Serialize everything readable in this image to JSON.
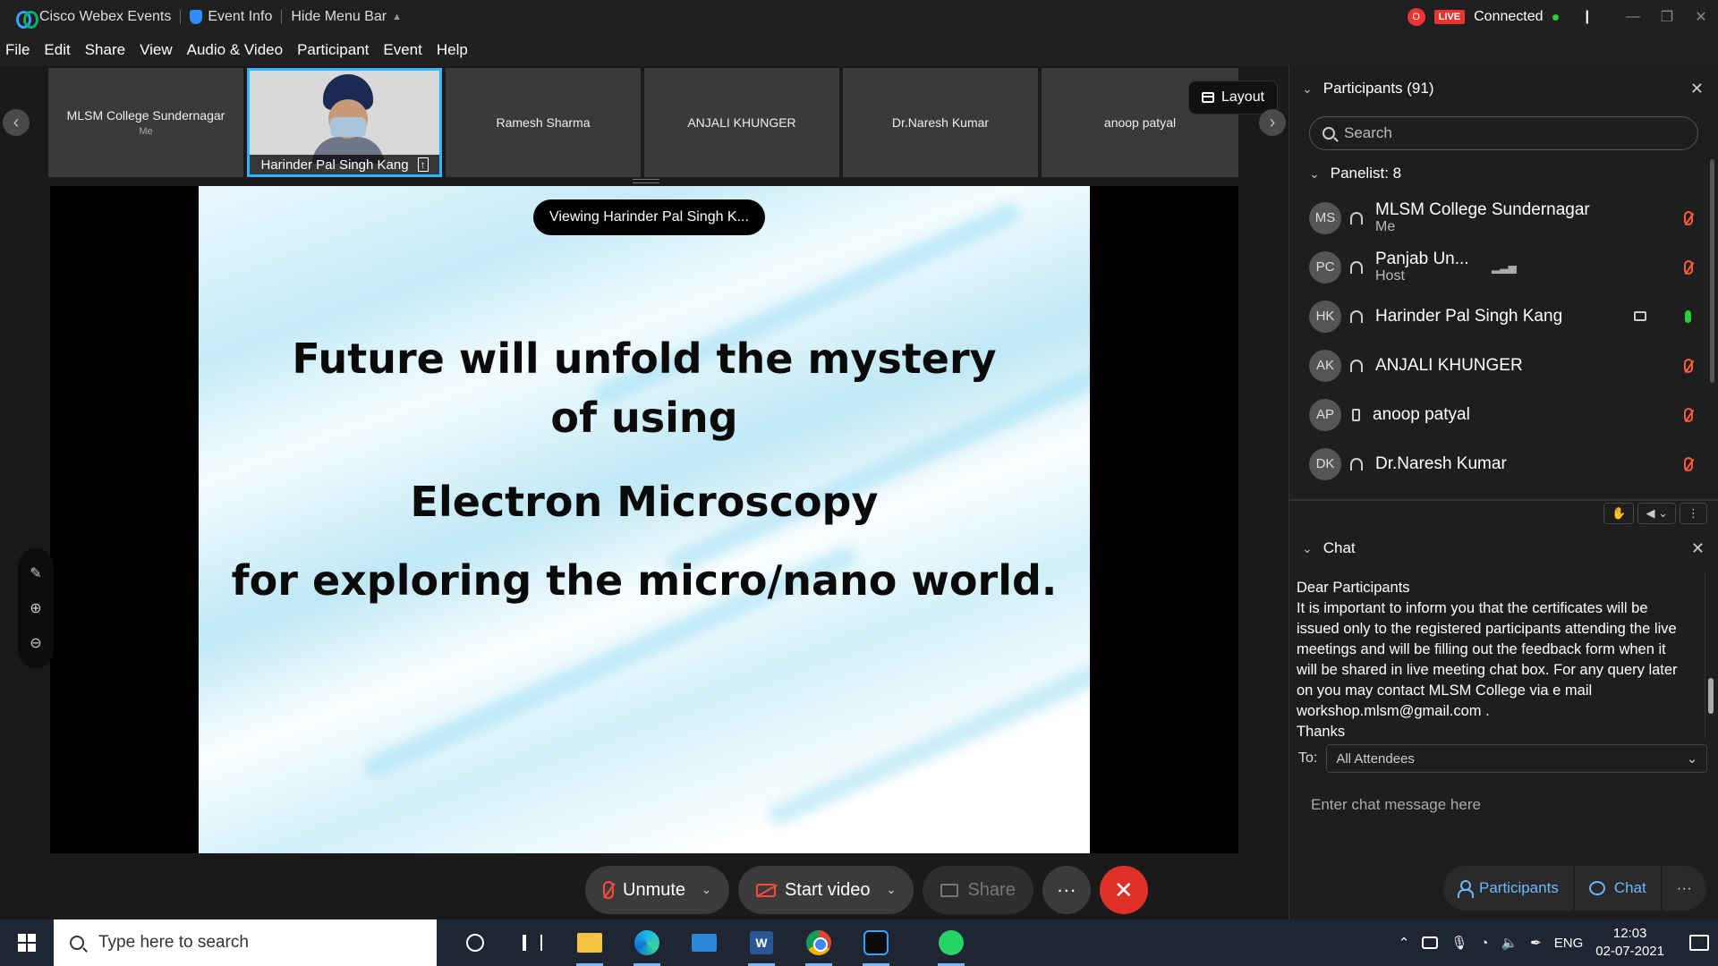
{
  "titlebar": {
    "app_name": "Cisco Webex Events",
    "event_info": "Event Info",
    "hide_menu": "Hide Menu Bar",
    "rec_label": "O",
    "live_label": "LIVE",
    "status": "Connected",
    "cursor_mark": "|"
  },
  "menu": [
    "File",
    "Edit",
    "Share",
    "View",
    "Audio & Video",
    "Participant",
    "Event",
    "Help"
  ],
  "filmstrip": {
    "tiles": [
      {
        "name": "MLSM College Sundernagar",
        "sub": "Me"
      },
      {
        "name": "Harinder Pal Singh Kang"
      },
      {
        "name": "Ramesh Sharma"
      },
      {
        "name": "ANJALI KHUNGER"
      },
      {
        "name": "Dr.Naresh Kumar"
      },
      {
        "name": "anoop patyal"
      }
    ],
    "layout_label": "Layout"
  },
  "viewing_label": "Viewing Harinder Pal Singh K...",
  "slide": {
    "line1": "Future will unfold the mystery",
    "line2": "of using",
    "line3": "Electron Microscopy",
    "line4": "for exploring the micro/nano world."
  },
  "participants_panel": {
    "title": "Participants (91)",
    "search_placeholder": "Search",
    "panelist_header": "Panelist: 8",
    "people": [
      {
        "initials": "MS",
        "name": "MLSM College Sundernagar",
        "role": "Me",
        "mic": "muted"
      },
      {
        "initials": "PC",
        "name": "Panjab Un...",
        "role": "Host",
        "mic": "muted"
      },
      {
        "initials": "HK",
        "name": "Harinder Pal Singh Kang",
        "role": "",
        "mic": "on"
      },
      {
        "initials": "AK",
        "name": "ANJALI KHUNGER",
        "role": "",
        "mic": "muted"
      },
      {
        "initials": "AP",
        "name": "anoop patyal",
        "role": "",
        "mic": "muted"
      },
      {
        "initials": "DK",
        "name": "Dr.Naresh Kumar",
        "role": "",
        "mic": "muted"
      }
    ]
  },
  "chat_panel": {
    "title": "Chat",
    "messages": [
      "Dear Participants",
      "It is important to inform you that the certificates will be issued only to the registered participants attending the live meetings and will be filling out the feedback form when it will be shared in live meeting chat box. For any query later on you may contact MLSM College via e mail workshop.mlsm@gmail.com .",
      "Thanks"
    ],
    "to_label": "To:",
    "to_value": "All Attendees",
    "input_placeholder": "Enter chat message here"
  },
  "bottom_tabs": {
    "participants": "Participants",
    "chat": "Chat",
    "more": "···"
  },
  "controls": {
    "unmute": "Unmute",
    "start_video": "Start video",
    "share": "Share",
    "more": "···",
    "leave": "✕"
  },
  "taskbar": {
    "search_placeholder": "Type here to search",
    "word_letter": "W",
    "language": "ENG",
    "time": "12:03",
    "date": "02-07-2021"
  }
}
